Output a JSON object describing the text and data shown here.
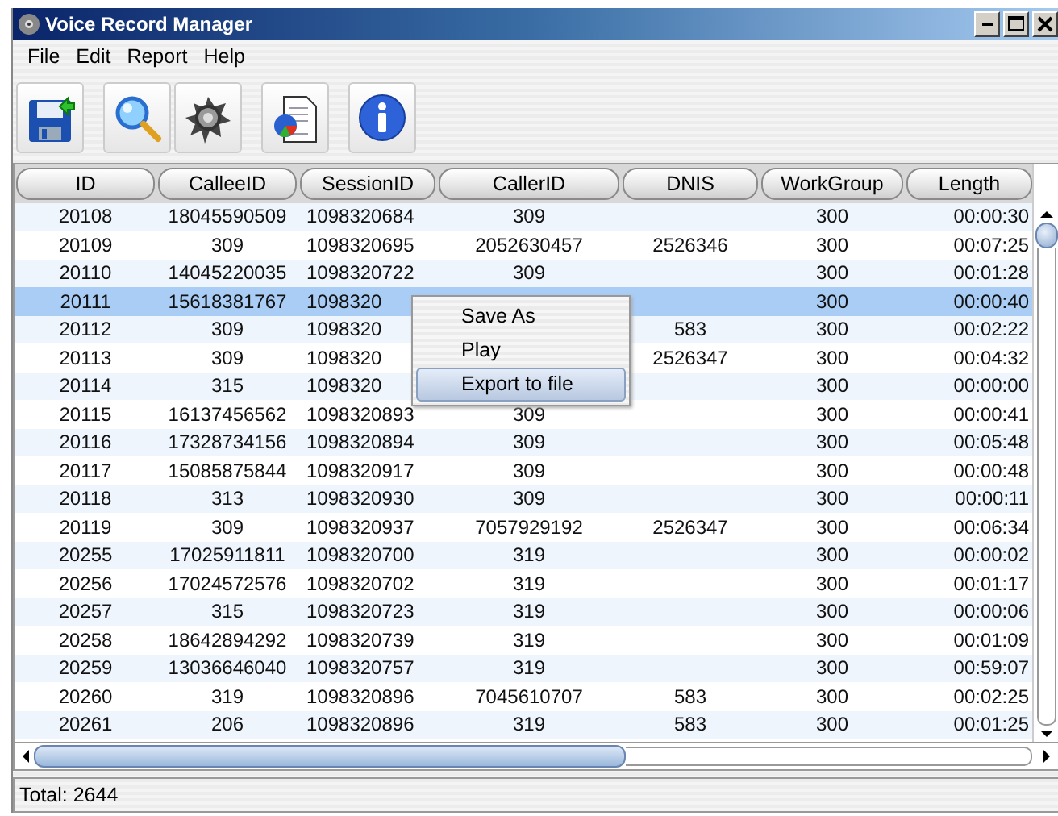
{
  "window": {
    "title": "Voice Record Manager"
  },
  "menu": [
    "File",
    "Edit",
    "Report",
    "Help"
  ],
  "toolbar": [
    {
      "kind": "save"
    },
    {
      "kind": "search"
    },
    {
      "kind": "speaker"
    },
    {
      "kind": "report"
    },
    {
      "kind": "info"
    }
  ],
  "table": {
    "columns": [
      "ID",
      "CalleeID",
      "SessionID",
      "CallerID",
      "DNIS",
      "WorkGroup",
      "Length"
    ],
    "rows": [
      {
        "selected": false,
        "cells": [
          "20108",
          "18045590509",
          "1098320684",
          "309",
          null,
          "300",
          "00:00:30"
        ]
      },
      {
        "selected": false,
        "cells": [
          "20109",
          "309",
          "1098320695",
          "2052630457",
          "2526346",
          "300",
          "00:07:25"
        ]
      },
      {
        "selected": false,
        "cells": [
          "20110",
          "14045220035",
          "1098320722",
          "309",
          null,
          "300",
          "00:01:28"
        ]
      },
      {
        "selected": true,
        "cells": [
          "20111",
          "15618381767",
          "1098320",
          null,
          null,
          "300",
          "00:00:40"
        ]
      },
      {
        "selected": false,
        "cells": [
          "20112",
          "309",
          "1098320",
          null,
          "583",
          "300",
          "00:02:22"
        ]
      },
      {
        "selected": false,
        "cells": [
          "20113",
          "309",
          "1098320",
          null,
          "2526347",
          "300",
          "00:04:32"
        ]
      },
      {
        "selected": false,
        "cells": [
          "20114",
          "315",
          "1098320",
          null,
          null,
          "300",
          "00:00:00"
        ]
      },
      {
        "selected": false,
        "cells": [
          "20115",
          "16137456562",
          "1098320893",
          "309",
          null,
          "300",
          "00:00:41"
        ]
      },
      {
        "selected": false,
        "cells": [
          "20116",
          "17328734156",
          "1098320894",
          "309",
          null,
          "300",
          "00:05:48"
        ]
      },
      {
        "selected": false,
        "cells": [
          "20117",
          "15085875844",
          "1098320917",
          "309",
          null,
          "300",
          "00:00:48"
        ]
      },
      {
        "selected": false,
        "cells": [
          "20118",
          "313",
          "1098320930",
          "309",
          null,
          "300",
          "00:00:11"
        ]
      },
      {
        "selected": false,
        "cells": [
          "20119",
          "309",
          "1098320937",
          "7057929192",
          "2526347",
          "300",
          "00:06:34"
        ]
      },
      {
        "selected": false,
        "cells": [
          "20255",
          "17025911811",
          "1098320700",
          "319",
          null,
          "300",
          "00:00:02"
        ]
      },
      {
        "selected": false,
        "cells": [
          "20256",
          "17024572576",
          "1098320702",
          "319",
          null,
          "300",
          "00:01:17"
        ]
      },
      {
        "selected": false,
        "cells": [
          "20257",
          "315",
          "1098320723",
          "319",
          null,
          "300",
          "00:00:06"
        ]
      },
      {
        "selected": false,
        "cells": [
          "20258",
          "18642894292",
          "1098320739",
          "319",
          null,
          "300",
          "00:01:09"
        ]
      },
      {
        "selected": false,
        "cells": [
          "20259",
          "13036646040",
          "1098320757",
          "319",
          null,
          "300",
          "00:59:07"
        ]
      },
      {
        "selected": false,
        "cells": [
          "20260",
          "319",
          "1098320896",
          "7045610707",
          "583",
          "300",
          "00:02:25"
        ]
      },
      {
        "selected": false,
        "cells": [
          "20261",
          "206",
          "1098320896",
          "319",
          "583",
          "300",
          "00:01:25"
        ]
      }
    ]
  },
  "context_menu": [
    {
      "label": "Save As",
      "selected": false
    },
    {
      "label": "Play",
      "selected": false
    },
    {
      "label": "Export to file",
      "selected": true
    }
  ],
  "status_bar": "Total: 2644"
}
